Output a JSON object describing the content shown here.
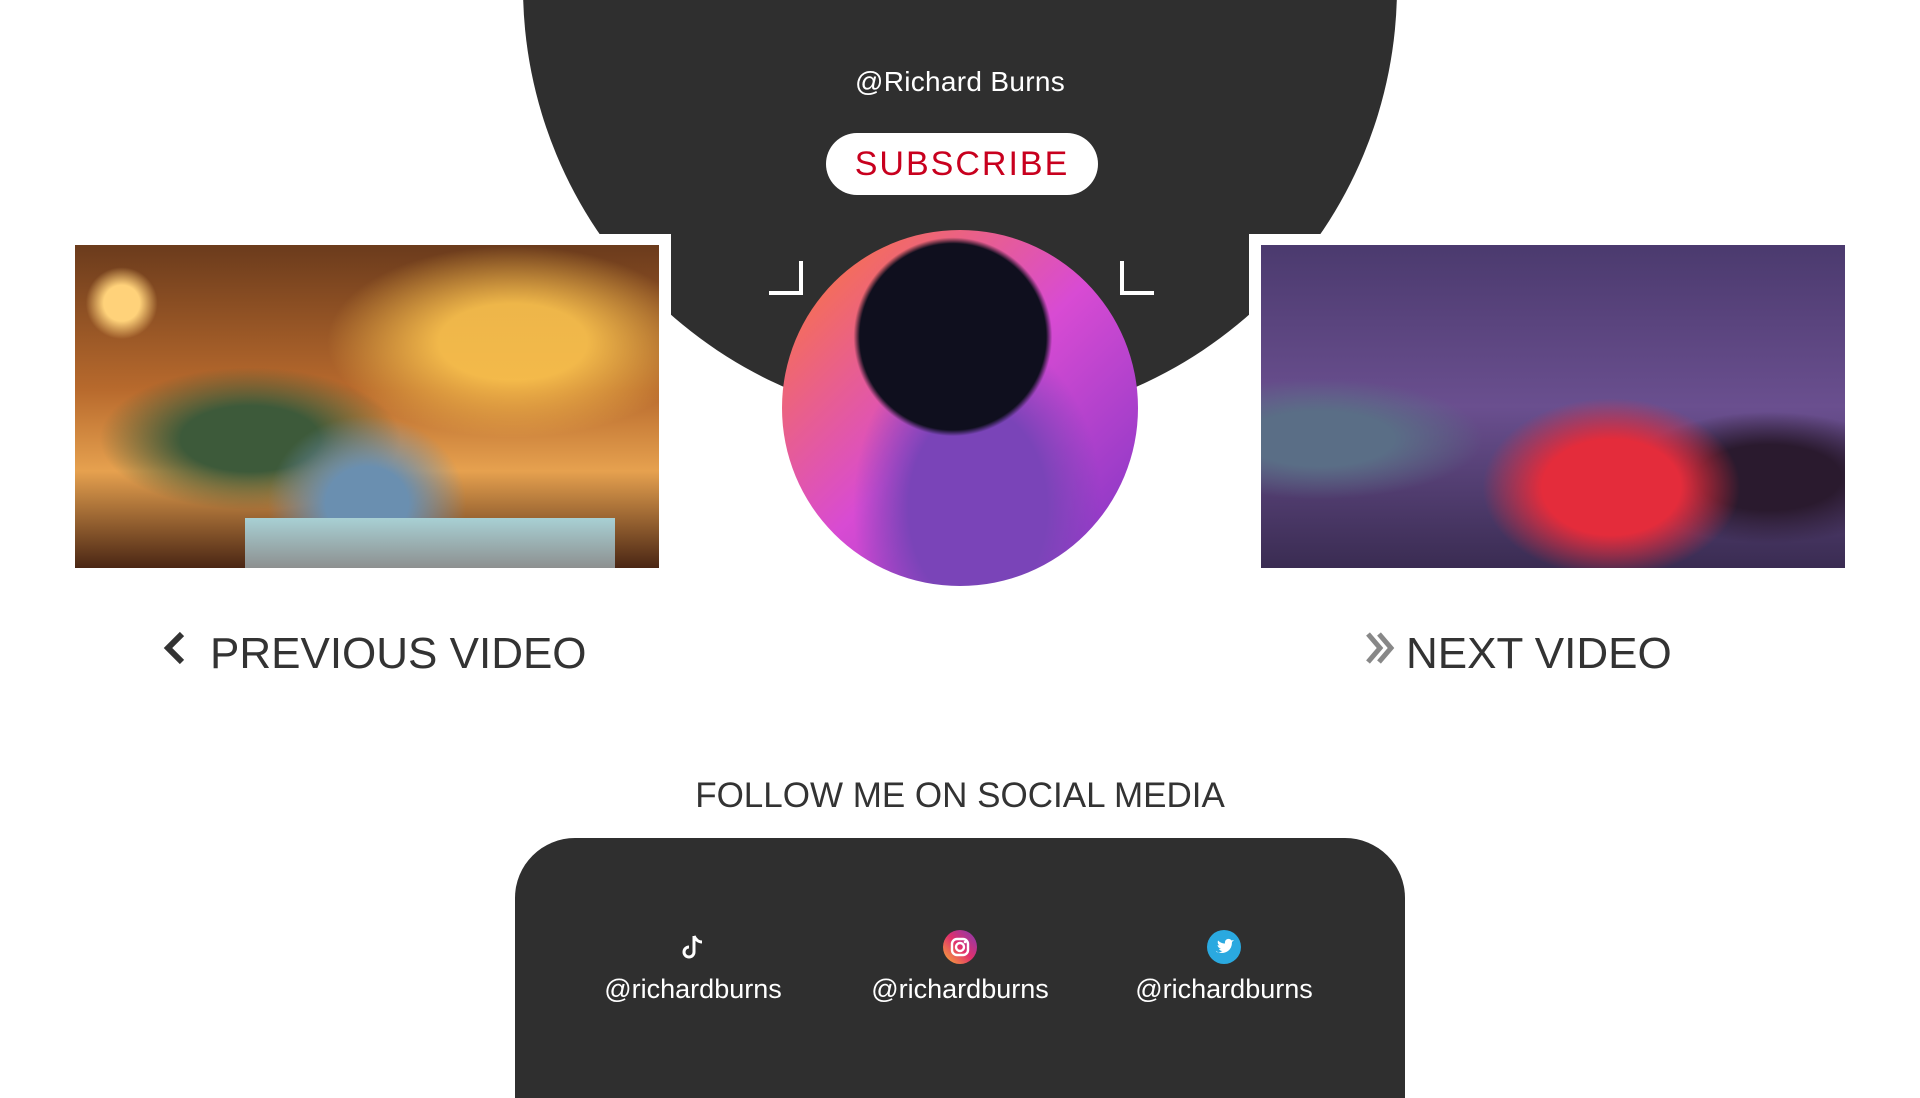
{
  "header": {
    "channel_name": "@Richard Burns",
    "subscribe_label": "SUBSCRIBE"
  },
  "navigation": {
    "previous_label": "PREVIOUS VIDEO",
    "next_label": "NEXT VIDEO"
  },
  "social": {
    "title": "FOLLOW ME ON SOCIAL MEDIA",
    "accounts": [
      {
        "platform_icon": "tiktok-icon",
        "handle": "@richardburns"
      },
      {
        "platform_icon": "instagram-icon",
        "handle": "@richardburns"
      },
      {
        "platform_icon": "twitter-icon",
        "handle": "@richardburns"
      }
    ]
  },
  "colors": {
    "panel": "#2f2f2f",
    "subscribe_text": "#c8001e",
    "text_dark": "#333333",
    "twitter_blue": "#2aa9e0"
  }
}
